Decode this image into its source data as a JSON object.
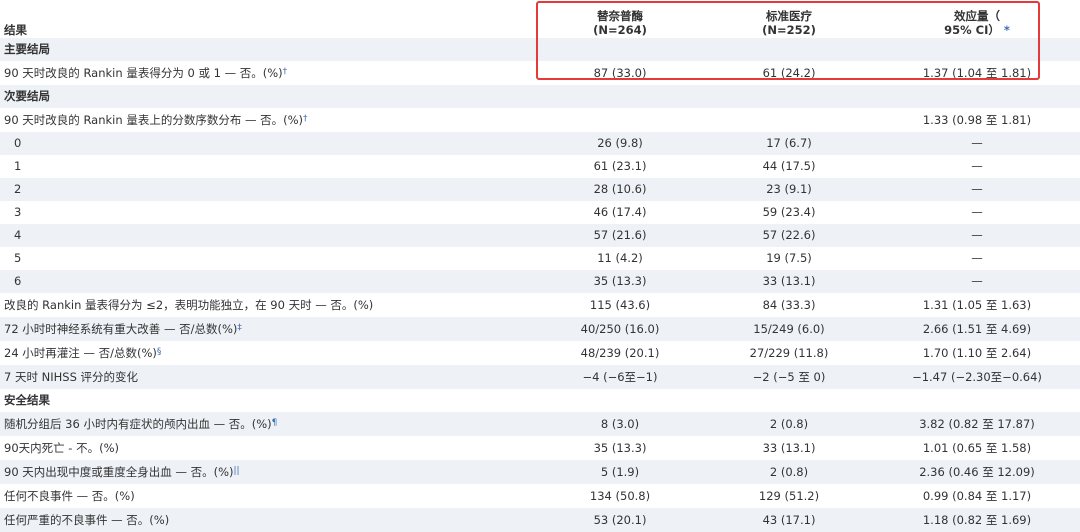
{
  "header": {
    "outcome_label": "结果",
    "tnk_name": "替奈普酶",
    "tnk_n": "(N=264)",
    "std_name": "标准医疗",
    "std_n": "(N=252)",
    "effect_line1": "效应量（",
    "effect_line2": "95% CI）",
    "effect_mark": "*"
  },
  "sections": {
    "primary": "主要结局",
    "secondary": "次要结局",
    "safety": "安全结果"
  },
  "primary_row": {
    "label": "90 天时改良的 Rankin 量表得分为 0 或 1 — 否。(%)",
    "mark": "†",
    "tnk": "87 (33.0)",
    "std": "61 (24.2)",
    "effect": "1.37 (1.04 至 1.81)"
  },
  "distribution_row": {
    "label": "90 天时改良的 Rankin 量表上的分数序数分布 — 否。(%)",
    "mark": "†",
    "tnk": "",
    "std": "",
    "effect": "1.33 (0.98 至 1.81)"
  },
  "scores": [
    {
      "score": "0",
      "tnk": "26 (9.8)",
      "std": "17 (6.7)",
      "effect": "—"
    },
    {
      "score": "1",
      "tnk": "61 (23.1)",
      "std": "44 (17.5)",
      "effect": "—"
    },
    {
      "score": "2",
      "tnk": "28 (10.6)",
      "std": "23 (9.1)",
      "effect": "—"
    },
    {
      "score": "3",
      "tnk": "46 (17.4)",
      "std": "59 (23.4)",
      "effect": "—"
    },
    {
      "score": "4",
      "tnk": "57 (21.6)",
      "std": "57 (22.6)",
      "effect": "—"
    },
    {
      "score": "5",
      "tnk": "11 (4.2)",
      "std": "19 (7.5)",
      "effect": "—"
    },
    {
      "score": "6",
      "tnk": "35 (13.3)",
      "std": "33 (13.1)",
      "effect": "—"
    }
  ],
  "secondary_rows": [
    {
      "label": "改良的 Rankin 量表得分为 ≤2，表明功能独立，在 90 天时 — 否。(%)",
      "mark": "",
      "tnk": "115 (43.6)",
      "std": "84 (33.3)",
      "effect": "1.31 (1.05 至 1.63)"
    },
    {
      "label": "72 小时时神经系统有重大改善 — 否/总数(%)",
      "mark": "‡",
      "tnk": "40/250 (16.0)",
      "std": "15/249 (6.0)",
      "effect": "2.66 (1.51 至 4.69)"
    },
    {
      "label": "24 小时再灌注 — 否/总数(%)",
      "mark": "§",
      "tnk": "48/239 (20.1)",
      "std": "27/229 (11.8)",
      "effect": "1.70 (1.10 至 2.64)"
    },
    {
      "label": "7 天时 NIHSS 评分的变化",
      "mark": "",
      "tnk": "−4 (−6至−1)",
      "std": "−2 (−5 至 0)",
      "effect": "−1.47 (−2.30至−0.64)"
    }
  ],
  "safety_rows": [
    {
      "label": "随机分组后 36 小时内有症状的颅内出血 — 否。(%)",
      "mark": "¶",
      "tnk": "8 (3.0)",
      "std": "2 (0.8)",
      "effect": "3.82 (0.82 至 17.87)"
    },
    {
      "label": "90天内死亡 - 不。(%)",
      "mark": "",
      "tnk": "35 (13.3)",
      "std": "33 (13.1)",
      "effect": "1.01 (0.65 至 1.58)"
    },
    {
      "label": "90 天内出现中度或重度全身出血 — 否。(%)",
      "mark": "||",
      "tnk": "5 (1.9)",
      "std": "2 (0.8)",
      "effect": "2.36 (0.46 至 12.09)"
    },
    {
      "label": "任何不良事件 — 否。(%)",
      "mark": "",
      "tnk": "134 (50.8)",
      "std": "129 (51.2)",
      "effect": "0.99 (0.84 至 1.17)"
    },
    {
      "label": "任何严重的不良事件 — 否。(%)",
      "mark": "",
      "tnk": "53 (20.1)",
      "std": "43 (17.1)",
      "effect": "1.18 (0.82 至 1.69)"
    }
  ],
  "colors": {
    "shade": "#eef2f6",
    "highlight_border": "#e43a3a",
    "footnote_mark": "#3d6db5"
  }
}
